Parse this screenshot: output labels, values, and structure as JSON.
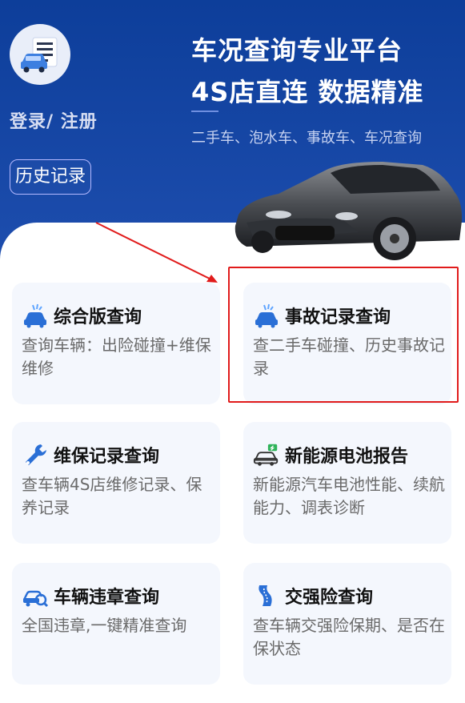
{
  "header": {
    "login_label": "登录/ 注册",
    "history_label": "历史记录",
    "headline_line1": "车况查询专业平台",
    "headline_line2": "4S店直连 数据精准",
    "subtitle": "二手车、泡水车、事故车、车况查询"
  },
  "cards": [
    {
      "icon": "car-crash-icon",
      "title": "综合版查询",
      "desc": "查询车辆：出险碰撞+维保维修"
    },
    {
      "icon": "car-crash-icon",
      "title": "事故记录查询",
      "desc": "查二手车碰撞、历史事故记录"
    },
    {
      "icon": "wrench-icon",
      "title": "维保记录查询",
      "desc": "查车辆4S店维修记录、保养记录"
    },
    {
      "icon": "ev-car-icon",
      "title": "新能源电池报告",
      "desc": "新能源汽车电池性能、续航能力、调表诊断"
    },
    {
      "icon": "car-search-icon",
      "title": "车辆违章查询",
      "desc": "全国违章,一键精准查询"
    },
    {
      "icon": "road-shield-icon",
      "title": "交强险查询",
      "desc": "查车辆交强险保期、是否在保状态"
    }
  ],
  "colors": {
    "header_bg": "#0d3e9a",
    "card_bg": "#f4f7fd",
    "icon_blue": "#2a6fd6",
    "annotation_red": "#e11b1b"
  }
}
